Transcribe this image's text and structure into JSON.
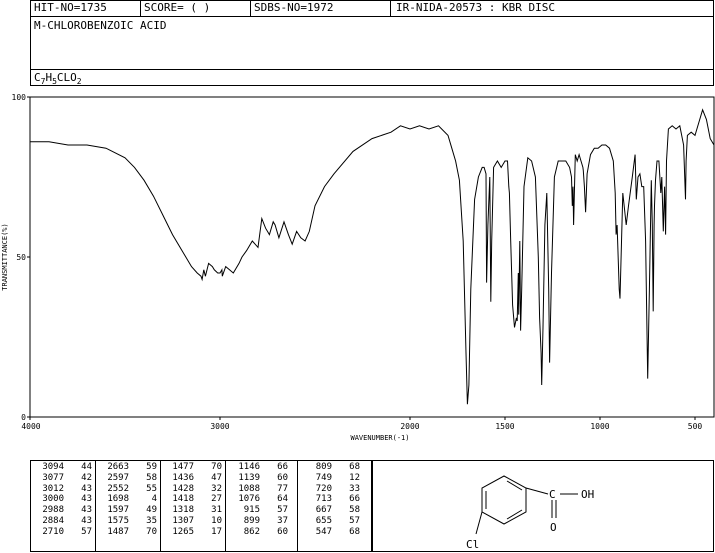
{
  "header": {
    "hit_no": "HIT-NO=1735",
    "score": "SCORE=  (  )",
    "sdbs_no": "SDBS-NO=1972",
    "ir_info": "IR-NIDA-20573 : KBR DISC",
    "compound_name": "M-CHLOROBENZOIC ACID",
    "formula": {
      "c": "C",
      "c_sub": "7",
      "h": "H",
      "h_sub": "5",
      "rest": "CLO",
      "o_sub": "2"
    }
  },
  "chart_data": {
    "type": "line",
    "title": "",
    "xlabel": "WAVENUMBER(-1)",
    "ylabel": "TRANSMITTANCE(%)",
    "xlim": [
      4000,
      400
    ],
    "ylim": [
      0,
      100
    ],
    "x_ticks": [
      4000,
      3000,
      2000,
      1500,
      1000,
      500
    ],
    "y_ticks": [
      0,
      50,
      100
    ],
    "series": [
      {
        "name": "",
        "x": [
          4000,
          3900,
          3800,
          3700,
          3600,
          3500,
          3450,
          3400,
          3350,
          3300,
          3250,
          3200,
          3150,
          3120,
          3100,
          3094,
          3085,
          3077,
          3060,
          3040,
          3030,
          3012,
          3000,
          2990,
          2988,
          2970,
          2950,
          2930,
          2900,
          2884,
          2860,
          2830,
          2800,
          2780,
          2760,
          2740,
          2720,
          2710,
          2690,
          2663,
          2640,
          2620,
          2597,
          2575,
          2552,
          2530,
          2500,
          2450,
          2400,
          2300,
          2200,
          2100,
          2050,
          2000,
          1950,
          1900,
          1850,
          1800,
          1780,
          1760,
          1740,
          1720,
          1705,
          1698,
          1690,
          1680,
          1660,
          1640,
          1620,
          1610,
          1600,
          1597,
          1590,
          1580,
          1575,
          1570,
          1560,
          1540,
          1520,
          1500,
          1487,
          1480,
          1477,
          1470,
          1460,
          1450,
          1440,
          1436,
          1430,
          1428,
          1422,
          1418,
          1412,
          1400,
          1380,
          1360,
          1340,
          1325,
          1318,
          1310,
          1307,
          1300,
          1290,
          1280,
          1270,
          1265,
          1255,
          1240,
          1220,
          1200,
          1180,
          1160,
          1150,
          1146,
          1142,
          1139,
          1130,
          1120,
          1110,
          1100,
          1090,
          1088,
          1082,
          1076,
          1068,
          1050,
          1030,
          1010,
          990,
          970,
          950,
          930,
          920,
          915,
          910,
          899,
          895,
          880,
          862,
          850,
          830,
          815,
          809,
          800,
          790,
          780,
          770,
          760,
          749,
          740,
          730,
          725,
          720,
          715,
          713,
          708,
          700,
          690,
          680,
          675,
          667,
          660,
          655,
          650,
          640,
          620,
          600,
          580,
          560,
          550,
          547,
          540,
          520,
          500,
          480,
          460,
          440,
          420,
          400
        ],
        "y": [
          86,
          86,
          85,
          85,
          84,
          81,
          78,
          74,
          69,
          63,
          57,
          52,
          47,
          45,
          44,
          43,
          46,
          44,
          48,
          47,
          46,
          45,
          45,
          46,
          44,
          47,
          46,
          45,
          48,
          50,
          52,
          55,
          53,
          62,
          59,
          57,
          61,
          60,
          56,
          61,
          57,
          54,
          58,
          56,
          55,
          58,
          66,
          72,
          76,
          83,
          87,
          89,
          91,
          90,
          91,
          90,
          91,
          88,
          84,
          80,
          74,
          55,
          20,
          4,
          10,
          40,
          68,
          75,
          78,
          78,
          76,
          42,
          60,
          75,
          36,
          55,
          78,
          80,
          78,
          80,
          80,
          72,
          70,
          55,
          35,
          28,
          31,
          30,
          45,
          32,
          55,
          27,
          40,
          72,
          81,
          80,
          75,
          50,
          31,
          20,
          10,
          28,
          60,
          70,
          40,
          17,
          45,
          75,
          80,
          80,
          80,
          78,
          75,
          66,
          72,
          60,
          82,
          80,
          82,
          80,
          78,
          77,
          72,
          64,
          76,
          82,
          84,
          84,
          85,
          85,
          84,
          80,
          70,
          57,
          60,
          40,
          37,
          70,
          60,
          66,
          75,
          82,
          68,
          75,
          76,
          72,
          72,
          55,
          12,
          40,
          74,
          60,
          33,
          60,
          66,
          74,
          80,
          80,
          70,
          75,
          58,
          72,
          57,
          80,
          90,
          91,
          90,
          91,
          85,
          68,
          80,
          88,
          89,
          88,
          92,
          96,
          93,
          87,
          85
        ]
      }
    ]
  },
  "peak_table": {
    "columns": [
      [
        [
          "3094",
          "44"
        ],
        [
          "3077",
          "42"
        ],
        [
          "3012",
          "43"
        ],
        [
          "3000",
          "43"
        ],
        [
          "2988",
          "43"
        ],
        [
          "2884",
          "43"
        ],
        [
          "2710",
          "57"
        ]
      ],
      [
        [
          "2663",
          "59"
        ],
        [
          "2597",
          "58"
        ],
        [
          "2552",
          "55"
        ],
        [
          "1698",
          "4"
        ],
        [
          "1597",
          "49"
        ],
        [
          "1575",
          "35"
        ],
        [
          "1487",
          "70"
        ]
      ],
      [
        [
          "1477",
          "70"
        ],
        [
          "1436",
          "47"
        ],
        [
          "1428",
          "32"
        ],
        [
          "1418",
          "27"
        ],
        [
          "1318",
          "31"
        ],
        [
          "1307",
          "10"
        ],
        [
          "1265",
          "17"
        ]
      ],
      [
        [
          "1146",
          "66"
        ],
        [
          "1139",
          "60"
        ],
        [
          "1088",
          "77"
        ],
        [
          "1076",
          "64"
        ],
        [
          "915",
          "57"
        ],
        [
          "899",
          "37"
        ],
        [
          "862",
          "60"
        ]
      ],
      [
        [
          "809",
          "68"
        ],
        [
          "749",
          "12"
        ],
        [
          "720",
          "33"
        ],
        [
          "713",
          "66"
        ],
        [
          "667",
          "58"
        ],
        [
          "655",
          "57"
        ],
        [
          "547",
          "68"
        ]
      ]
    ]
  },
  "structure": {
    "substituent_left": "Cl",
    "carbonyl_label": "C",
    "hydroxyl_label": "OH",
    "oxygen_label": "O"
  }
}
